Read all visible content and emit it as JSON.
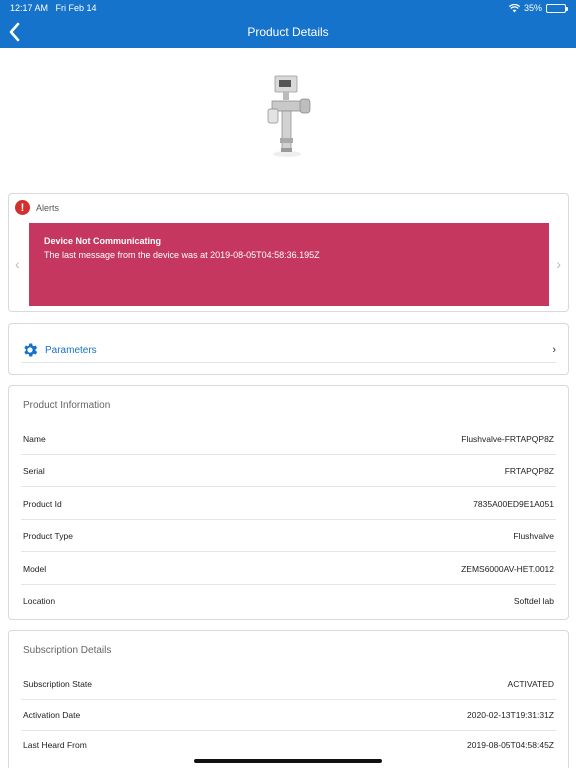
{
  "status_bar": {
    "time": "12:17 AM",
    "date": "Fri Feb 14",
    "battery": "35%",
    "battery_level": 0.35
  },
  "header": {
    "title": "Product Details",
    "back_icon": "chevron-left-icon"
  },
  "alerts": {
    "label": "Alerts",
    "icon": "alert-icon",
    "items": [
      {
        "title": "Device Not Communicating",
        "message": "The last message from the device was at 2019-08-05T04:58:36.195Z"
      }
    ],
    "color": "#c6375f"
  },
  "parameters": {
    "label": "Parameters",
    "icon": "gear-icon",
    "arrow": "›"
  },
  "product_info": {
    "title": "Product Information",
    "rows": [
      {
        "label": "Name",
        "value": "Flushvalve-FRTAPQP8Z"
      },
      {
        "label": "Serial",
        "value": "FRTAPQP8Z"
      },
      {
        "label": "Product Id",
        "value": "7835A00ED9E1A051"
      },
      {
        "label": "Product Type",
        "value": "Flushvalve"
      },
      {
        "label": "Model",
        "value": "ZEMS6000AV-HET.0012"
      },
      {
        "label": "Location",
        "value": "Softdel lab"
      }
    ]
  },
  "subscription": {
    "title": "Subscription Details",
    "rows": [
      {
        "label": "Subscription State",
        "value": "ACTIVATED"
      },
      {
        "label": "Activation Date",
        "value": "2020-02-13T19:31:31Z"
      },
      {
        "label": "Last Heard From",
        "value": "2019-08-05T04:58:45Z"
      }
    ]
  },
  "colors": {
    "primary": "#1573cb",
    "alert": "#c6375f",
    "alert_icon": "#d32f2f"
  }
}
